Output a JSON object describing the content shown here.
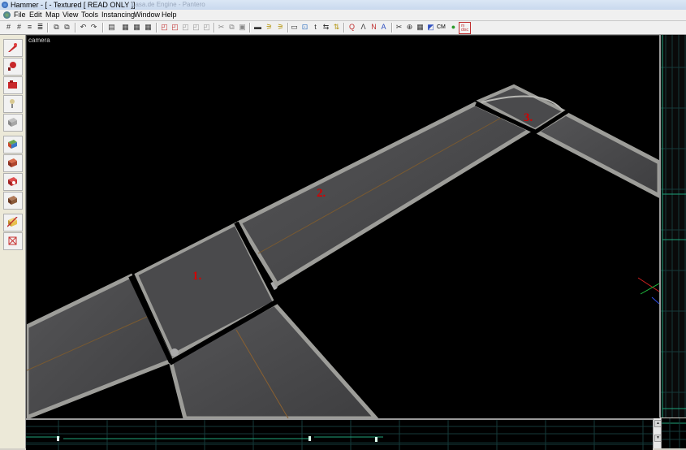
{
  "window": {
    "title": "Hammer - [ - Textured [ READ ONLY ]]",
    "background_title": "Lasa.de Engine - Pantero"
  },
  "menu": {
    "items": [
      "File",
      "Edit",
      "Map",
      "View",
      "Tools",
      "Instancing",
      "Window",
      "Help"
    ]
  },
  "toolbar": {
    "cm_label": "CM",
    "red_label": "m\ndisc"
  },
  "tools": {
    "items": [
      {
        "name": "selection-tool",
        "color": "#c8282a"
      },
      {
        "name": "magnify-tool",
        "color": "#c8282a"
      },
      {
        "name": "camera-tool",
        "color": "#c8282a"
      },
      {
        "name": "entity-tool",
        "color": "#d8c890"
      },
      {
        "name": "block-tool",
        "color": "#9a9a9a"
      },
      {
        "name": "texture-application-tool",
        "color": "#6aa84f"
      },
      {
        "name": "apply-current-texture-tool",
        "color": "#b0462e"
      },
      {
        "name": "decal-tool",
        "color": "#c83030"
      },
      {
        "name": "overlay-tool",
        "color": "#8a5a3a"
      },
      {
        "name": "clipping-tool",
        "color": "#e8c050"
      },
      {
        "name": "vertex-tool",
        "color": "#c83030"
      }
    ]
  },
  "viewport": {
    "label": "camera",
    "annotations": [
      {
        "text": "1."
      },
      {
        "text": "2."
      },
      {
        "text": "3."
      }
    ]
  },
  "colors": {
    "annotation": "#d40000",
    "grid_line": "#1d4d4d",
    "green_line": "#1fa37a",
    "road": "#48484a",
    "curb": "#9d9d99"
  }
}
